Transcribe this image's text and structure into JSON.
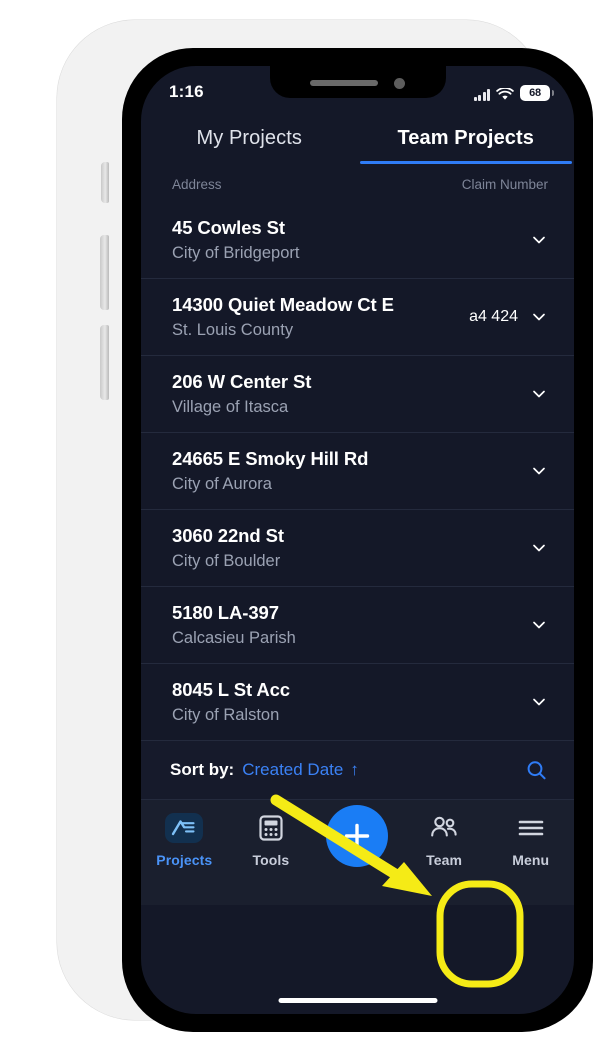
{
  "device": {
    "status_bar": {
      "time": "1:16",
      "cellular_icon": "cellular-bars-icon",
      "wifi_icon": "wifi-icon",
      "battery_level": "68"
    },
    "home_indicator": "home-indicator"
  },
  "tabs": [
    {
      "label": "My Projects",
      "active": false
    },
    {
      "label": "Team Projects",
      "active": true
    }
  ],
  "column_headers": {
    "left": "Address",
    "right": "Claim Number"
  },
  "projects": [
    {
      "address": "45 Cowles St",
      "locality": "City of Bridgeport",
      "claim": ""
    },
    {
      "address": "14300 Quiet Meadow Ct E",
      "locality": "St. Louis County",
      "claim": "a4 424"
    },
    {
      "address": "206 W Center St",
      "locality": "Village of Itasca",
      "claim": ""
    },
    {
      "address": "24665 E Smoky Hill Rd",
      "locality": "City of Aurora",
      "claim": ""
    },
    {
      "address": "3060 22nd St",
      "locality": "City of Boulder",
      "claim": ""
    },
    {
      "address": "5180 LA-397",
      "locality": "Calcasieu Parish",
      "claim": ""
    },
    {
      "address": "8045 L St Acc",
      "locality": "City of Ralston",
      "claim": ""
    }
  ],
  "sort_bar": {
    "label": "Sort by:",
    "value": "Created Date",
    "direction_arrow": "↑",
    "search_icon": "search-icon"
  },
  "bottom_nav": [
    {
      "label": "Projects",
      "icon": "projects-logo-icon",
      "active": true
    },
    {
      "label": "Tools",
      "icon": "calculator-icon",
      "active": false
    },
    {
      "label": "",
      "icon": "plus-icon",
      "active": false
    },
    {
      "label": "Team",
      "icon": "people-icon",
      "active": false
    },
    {
      "label": "Menu",
      "icon": "hamburger-icon",
      "active": false
    }
  ],
  "annotations": {
    "arrow": {
      "color": "#f5eb16",
      "target": "menu-nav-item"
    },
    "highlight_ring": {
      "color": "#f5eb16",
      "target": "menu-nav-item"
    }
  },
  "colors": {
    "screen_bg": "#141828",
    "nav_bg": "#1a1f2e",
    "accent_blue": "#3b82f6",
    "fab_blue": "#1a7df5",
    "annotation_yellow": "#f5eb16",
    "muted_text": "#9ba2b3"
  }
}
